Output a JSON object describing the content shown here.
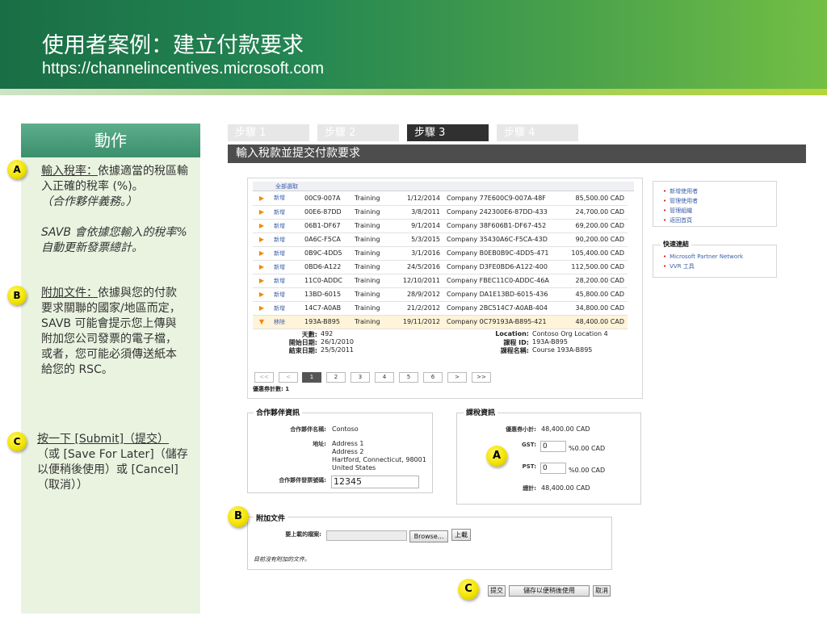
{
  "slide": {
    "title": "使用者案例：建立付款要求",
    "url": "https://channelincentives.microsoft.com"
  },
  "panel": {
    "heading": "動作",
    "itemA": {
      "marker": "A",
      "label": "輸入稅率：",
      "text": "依據適當的稅區輸入正確的稅率 (%)。",
      "note": "（合作夥伴義務。）",
      "note2": "SAVB 會依據您輸入的稅率% 自動更新發票總計。"
    },
    "itemB": {
      "marker": "B",
      "label": "附加文件：",
      "text": "依據與您的付款要求關聯的國家/地區而定，SAVB 可能會提示您上傳與附加您公司發票的電子檔，或者，您可能必須傳送紙本給您的 RSC。"
    },
    "itemC": {
      "marker": "C",
      "label": "按一下 [Submit]（提交）",
      "text": "（或 [Save For Later]（儲存以便稍後使用）或 [Cancel]（取消））"
    }
  },
  "steps": [
    "步驟 1",
    "步驟 2",
    "步驟 3",
    "步驟 4"
  ],
  "active_step": "步驟 3",
  "stepbar": "輸入稅款並提交付款要求",
  "invoices": {
    "header_stub": "全部選取",
    "rows": [
      {
        "act": "新增",
        "num": "00C9-007A",
        "type": "Training",
        "date": "1/12/2014",
        "company": "Company 77E600C9-007A-48F",
        "amount": "85,500.00 CAD"
      },
      {
        "act": "新增",
        "num": "00E6-87DD",
        "type": "Training",
        "date": "3/8/2011",
        "company": "Company 242300E6-87DD-433",
        "amount": "24,700.00 CAD"
      },
      {
        "act": "新增",
        "num": "06B1-DF67",
        "type": "Training",
        "date": "9/1/2014",
        "company": "Company 38F606B1-DF67-452",
        "amount": "69,200.00 CAD"
      },
      {
        "act": "新增",
        "num": "0A6C-F5CA",
        "type": "Training",
        "date": "5/3/2015",
        "company": "Company 35430A6C-F5CA-43D",
        "amount": "90,200.00 CAD"
      },
      {
        "act": "新增",
        "num": "0B9C-4DD5",
        "type": "Training",
        "date": "3/1/2016",
        "company": "Company B0EB0B9C-4DD5-471",
        "amount": "105,400.00 CAD"
      },
      {
        "act": "新增",
        "num": "0BD6-A122",
        "type": "Training",
        "date": "24/5/2016",
        "company": "Company D3FE0BD6-A122-400",
        "amount": "112,500.00 CAD"
      },
      {
        "act": "新增",
        "num": "11C0-ADDC",
        "type": "Training",
        "date": "12/10/2011",
        "company": "Company FBEC11C0-ADDC-46A",
        "amount": "28,200.00 CAD"
      },
      {
        "act": "新增",
        "num": "13BD-6015",
        "type": "Training",
        "date": "28/9/2012",
        "company": "Company DA1E13BD-6015-436",
        "amount": "45,800.00 CAD"
      },
      {
        "act": "新增",
        "num": "14C7-A0AB",
        "type": "Training",
        "date": "21/2/2012",
        "company": "Company 2BC514C7-A0AB-404",
        "amount": "34,800.00 CAD"
      },
      {
        "act": "移除",
        "num": "193A-B895",
        "type": "Training",
        "date": "19/11/2012",
        "company": "Company 0C79193A-B895-421",
        "amount": "48,400.00 CAD"
      }
    ],
    "detail": {
      "days_label": "天數:",
      "days": "492",
      "start_label": "開始日期:",
      "start": "26/1/2010",
      "end_label": "結束日期:",
      "end": "25/5/2011",
      "loc_label": "Location:",
      "loc": "Contoso Org Location 4",
      "course_id_label": "課程 ID:",
      "course_id": "193A-B895",
      "course_name_label": "課程名稱:",
      "course_name": "Course 193A-B895"
    },
    "pager": [
      "<<",
      "<",
      "1",
      "2",
      "3",
      "4",
      "5",
      "6",
      ">",
      ">>"
    ],
    "pager_current": "1",
    "coupon_count": "優惠券計數: 1"
  },
  "right_links": [
    "新增使用者",
    "管理使用者",
    "管理組織",
    "返回首頁"
  ],
  "quick_links": {
    "title": "快速連結",
    "items": [
      "Microsoft Partner Network",
      "VVR 工具"
    ]
  },
  "partner_info": {
    "title": "合作夥伴資訊",
    "name_label": "合作夥伴名稱:",
    "name": "Contoso",
    "addr_label": "地址:",
    "addr": [
      "Address 1",
      "Address 2",
      "Hartford, Connecticut, 98001",
      "United States"
    ],
    "invoice_label": "合作夥伴發票號碼:",
    "invoice_value": "12345"
  },
  "tax_info": {
    "title": "課稅資訊",
    "subtotal_label": "優惠券小計:",
    "subtotal": "48,400.00 CAD",
    "gst_label": "GST:",
    "gst_value": "0",
    "gst_result": "%0.00 CAD",
    "pst_label": "PST:",
    "pst_value": "0",
    "pst_result": "%0.00 CAD",
    "total_label": "總計:",
    "total": "48,400.00 CAD"
  },
  "attachments": {
    "title": "附加文件",
    "upload_label": "要上載的檔案:",
    "browse": "Browse...",
    "upload": "上載",
    "none_note": "目前沒有附加的文件。"
  },
  "actions": {
    "submit": "提交",
    "save": "儲存以便稍後使用",
    "cancel": "取消"
  },
  "markers": {
    "a": "A",
    "b": "B",
    "c": "C"
  },
  "colors": {
    "banner": "#238552",
    "panel_bg": "#eaf3e0",
    "marker": "#f3e400",
    "stepbar": "#4d4d4d"
  }
}
